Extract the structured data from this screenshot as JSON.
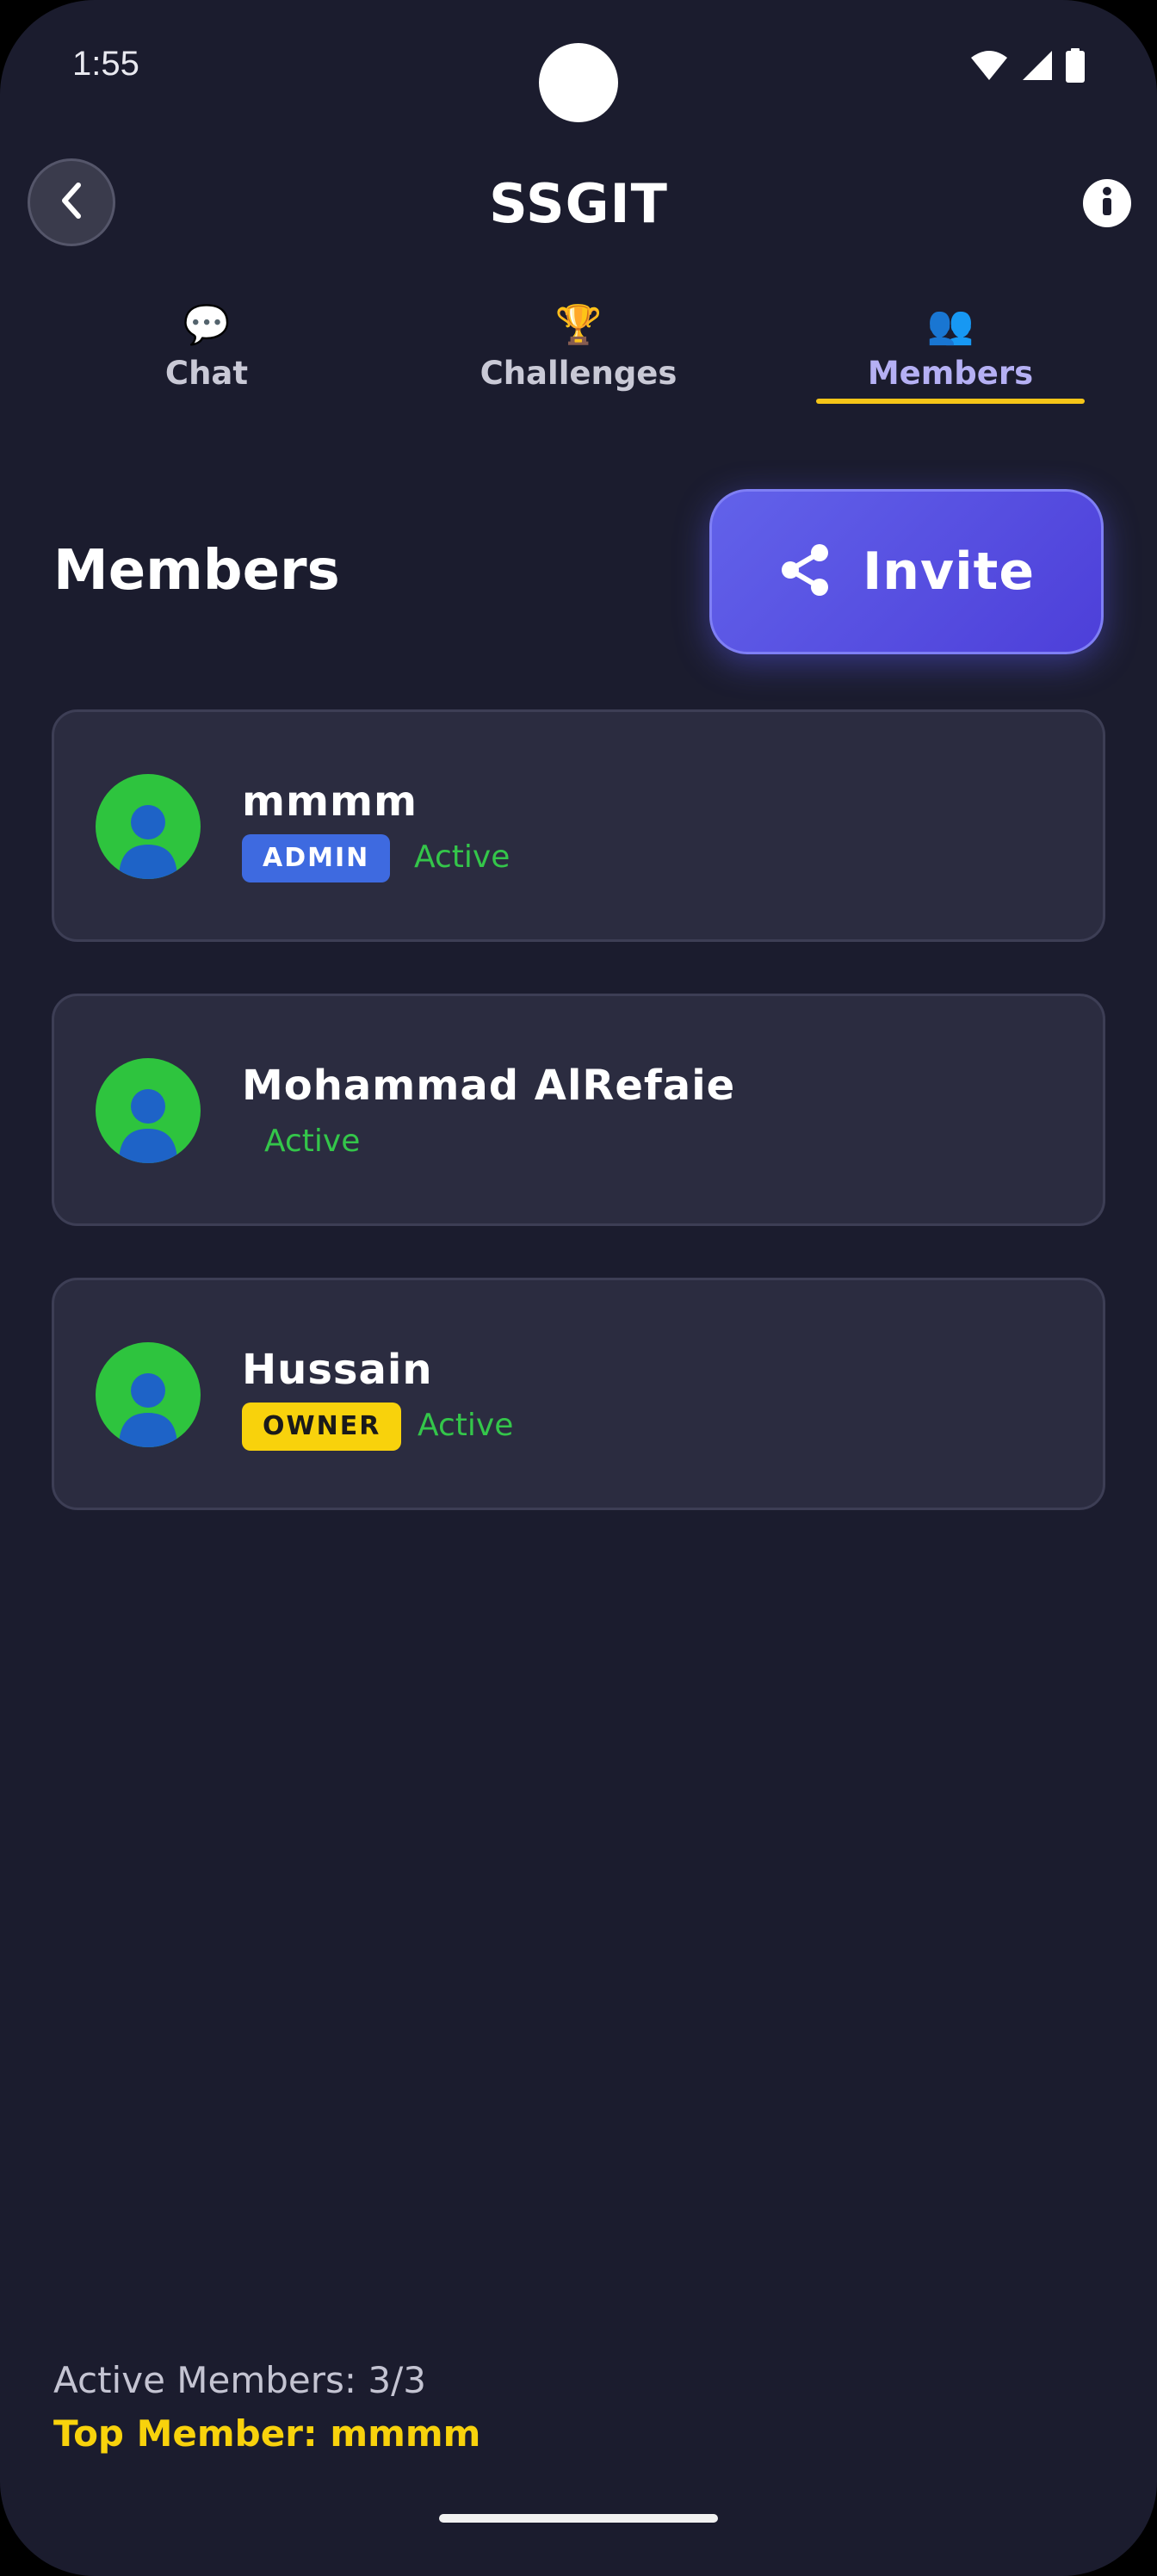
{
  "status_bar": {
    "time": "1:55",
    "icons": [
      "wifi-icon",
      "signal-icon",
      "battery-icon"
    ]
  },
  "header": {
    "title": "SSGIT",
    "back_icon": "chevron-left-icon",
    "info_icon": "info-icon"
  },
  "tabs": [
    {
      "label": "Chat",
      "icon": "💬",
      "active": false
    },
    {
      "label": "Challenges",
      "icon": "🏆",
      "active": false
    },
    {
      "label": "Members",
      "icon": "👥",
      "active": true
    }
  ],
  "section": {
    "title": "Members",
    "invite_label": "Invite",
    "invite_icon": "share-icon"
  },
  "members": [
    {
      "name": "mmmm",
      "role": "ADMIN",
      "status": "Active"
    },
    {
      "name": "Mohammad AlRefaie",
      "role": "",
      "status": "Active"
    },
    {
      "name": "Hussain",
      "role": "OWNER",
      "status": "Active"
    }
  ],
  "footer": {
    "active_members": "Active Members: 3/3",
    "top_member": "Top Member: mmmm"
  },
  "colors": {
    "background": "#1b1c2e",
    "card": "#2b2c40",
    "accent": "#5a54e6",
    "tab_underline": "#f5c518",
    "admin_badge": "#3e6ae0",
    "owner_badge": "#f8d20c",
    "active_status": "#34c64a",
    "avatar": "#2ec43e"
  }
}
